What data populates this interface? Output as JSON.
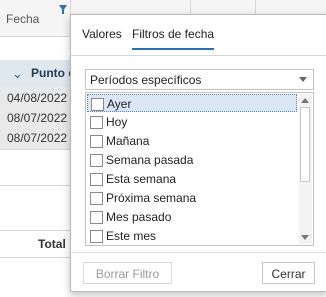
{
  "grid": {
    "column_header": "Fecha",
    "group_row_label": "Punto d",
    "rows": [
      "04/08/2022",
      "08/07/2022",
      "08/07/2022"
    ],
    "total_label": "Total"
  },
  "filter_popup": {
    "tabs": [
      {
        "label": "Valores",
        "active": false
      },
      {
        "label": "Filtros de fecha",
        "active": true
      }
    ],
    "mode_select": {
      "value": "Períodos específicos"
    },
    "periods": [
      {
        "label": "Ayer",
        "checked": false,
        "focused": true
      },
      {
        "label": "Hoy",
        "checked": false
      },
      {
        "label": "Mañana",
        "checked": false
      },
      {
        "label": "Semana pasada",
        "checked": false
      },
      {
        "label": "Esta semana",
        "checked": false
      },
      {
        "label": "Próxima semana",
        "checked": false
      },
      {
        "label": "Mes pasado",
        "checked": false
      },
      {
        "label": "Este mes",
        "checked": false
      }
    ],
    "clear_button": {
      "label": "Borrar Filtro",
      "enabled": false
    },
    "close_button": {
      "label": "Cerrar",
      "enabled": true
    }
  },
  "colors": {
    "accent": "#2f6db5",
    "group_row_bg": "#dfe7ef",
    "selected_item_bg": "#dbe7f5"
  }
}
